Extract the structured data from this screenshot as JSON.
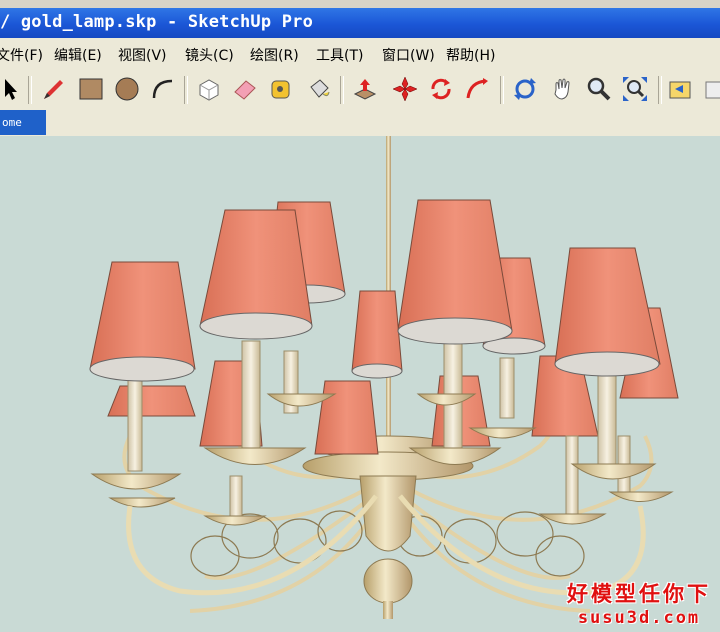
{
  "window": {
    "title": "/ gold_lamp.skp - SketchUp Pro"
  },
  "menu": {
    "items": [
      "文件(F)",
      "编辑(E)",
      "视图(V)",
      "镜头(C)",
      "绘图(R)",
      "工具(T)",
      "窗口(W)",
      "帮助(H)"
    ]
  },
  "toolbar": {
    "tools": [
      "select-tool",
      "pencil-tool",
      "rectangle-tool",
      "circle-tool",
      "arc-tool",
      "make-component-tool",
      "eraser-tool",
      "tape-measure-tool",
      "paint-bucket-tool",
      "push-pull-tool",
      "move-tool",
      "rotate-tool",
      "follow-me-tool",
      "orbit-tool",
      "pan-tool",
      "zoom-tool",
      "zoom-extents-tool",
      "previous-view-tool",
      "next-tool"
    ]
  },
  "scenes": {
    "active_tab": "ome"
  },
  "watermark": {
    "line1": "好模型任你下",
    "line2": "susu3d.com"
  },
  "colors": {
    "viewport_bg": "#c9dad5",
    "shade": "#e8876c",
    "brass": "#e9dcb2"
  }
}
